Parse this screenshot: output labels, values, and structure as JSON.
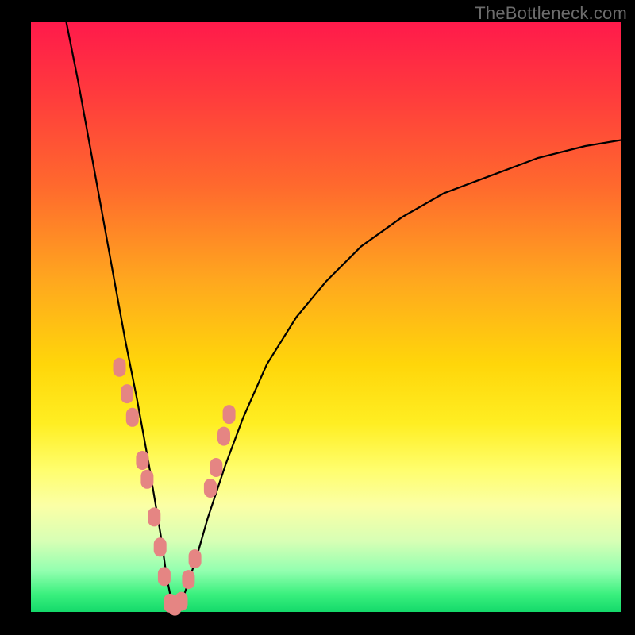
{
  "watermark": "TheBottleneck.com",
  "colors": {
    "dot_fill": "#e58583",
    "curve_stroke": "#000000",
    "frame": "#000000"
  },
  "chart_data": {
    "type": "line",
    "title": "",
    "xlabel": "",
    "ylabel": "",
    "xlim": [
      0,
      100
    ],
    "ylim": [
      0,
      100
    ],
    "grid": false,
    "legend": false,
    "notes": "Axes are shown without tick labels; values are estimated from pixel positions on a 0–100 scale per axis. The curve forms a V reaching y≈0 near x≈24. The right branch rises asymptotically.",
    "series": [
      {
        "name": "bottleneck-curve",
        "style": "line",
        "color": "#000000",
        "x": [
          6,
          8,
          10,
          12,
          14,
          16,
          18,
          20,
          22,
          23,
          24,
          25,
          26,
          28,
          30,
          33,
          36,
          40,
          45,
          50,
          56,
          63,
          70,
          78,
          86,
          94,
          100
        ],
        "y": [
          100,
          90,
          79,
          68,
          57,
          46,
          36,
          25,
          13,
          6,
          1,
          1,
          3,
          9,
          16,
          25,
          33,
          42,
          50,
          56,
          62,
          67,
          71,
          74,
          77,
          79,
          80
        ]
      },
      {
        "name": "data-points",
        "style": "scatter",
        "color": "#e58583",
        "x": [
          15.0,
          16.3,
          17.2,
          18.9,
          19.7,
          20.9,
          21.9,
          22.6,
          23.6,
          24.4,
          25.5,
          26.7,
          27.8,
          30.4,
          31.4,
          32.7,
          33.6
        ],
        "y": [
          41.5,
          37.0,
          33.0,
          25.7,
          22.5,
          16.1,
          11.0,
          6.0,
          1.5,
          1.0,
          1.8,
          5.5,
          9.0,
          21.0,
          24.5,
          29.8,
          33.5
        ]
      }
    ]
  }
}
